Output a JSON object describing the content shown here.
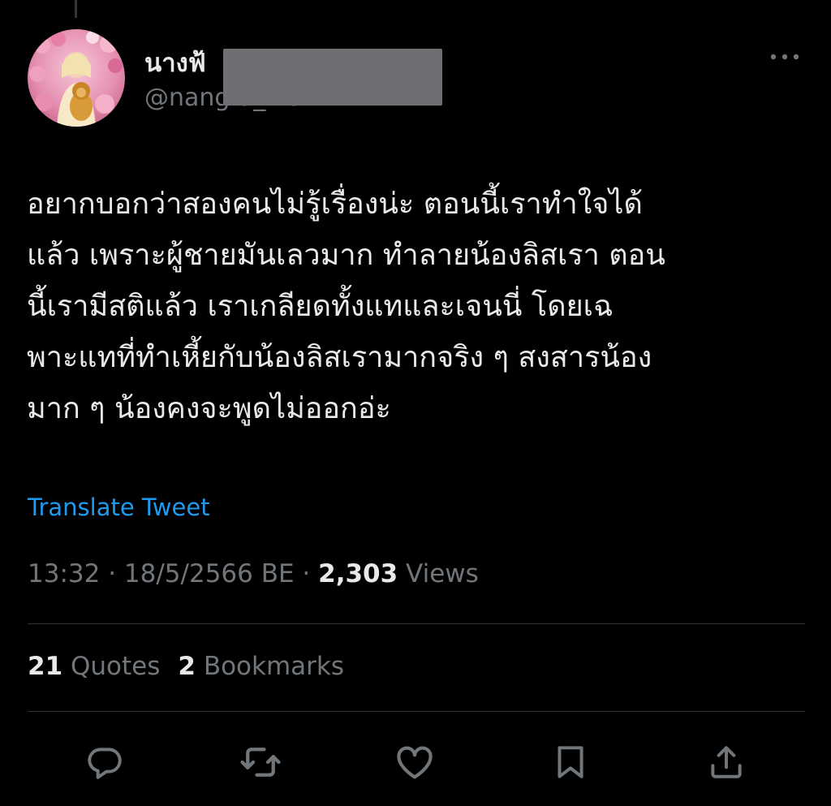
{
  "user": {
    "display_name": "นางฟ้",
    "handle": "@nangfa_we"
  },
  "tweet": {
    "lines": [
      "อยากบอกว่าสองคนไม่รู้เรื่องน่ะ ตอนนี้เราทำใจได้",
      "แล้ว เพราะผู้ชายมันเลวมาก ทำลายน้องลิสเรา ตอน",
      "นี้เรามีสติแล้ว เราเกลียดทั้งแทและเจนนี่ โดยเฉ",
      "พาะแทที่ทำเหี้ยกับน้องลิสเรามากจริง ๆ สงสารน้อง",
      "มาก ๆ น้องคงจะพูดไม่ออกอ่ะ"
    ],
    "translate_label": "Translate Tweet"
  },
  "meta": {
    "time": "13:32",
    "separator": " · ",
    "date": "18/5/2566 BE",
    "views_count": "2,303",
    "views_label": " Views"
  },
  "stats": {
    "quotes_count": "21",
    "quotes_label": " Quotes",
    "bookmarks_count": "2",
    "bookmarks_label": " Bookmarks"
  },
  "icons": {
    "more": "more-icon",
    "reply": "reply-icon",
    "retweet": "retweet-icon",
    "like": "heart-icon",
    "bookmark": "bookmark-icon",
    "share": "share-icon"
  },
  "colors": {
    "background": "#000000",
    "text_primary": "#e7e9ea",
    "text_secondary": "#71767b",
    "accent": "#1d9bf0",
    "divider": "#2f3336",
    "redaction": "#6e6e73"
  }
}
